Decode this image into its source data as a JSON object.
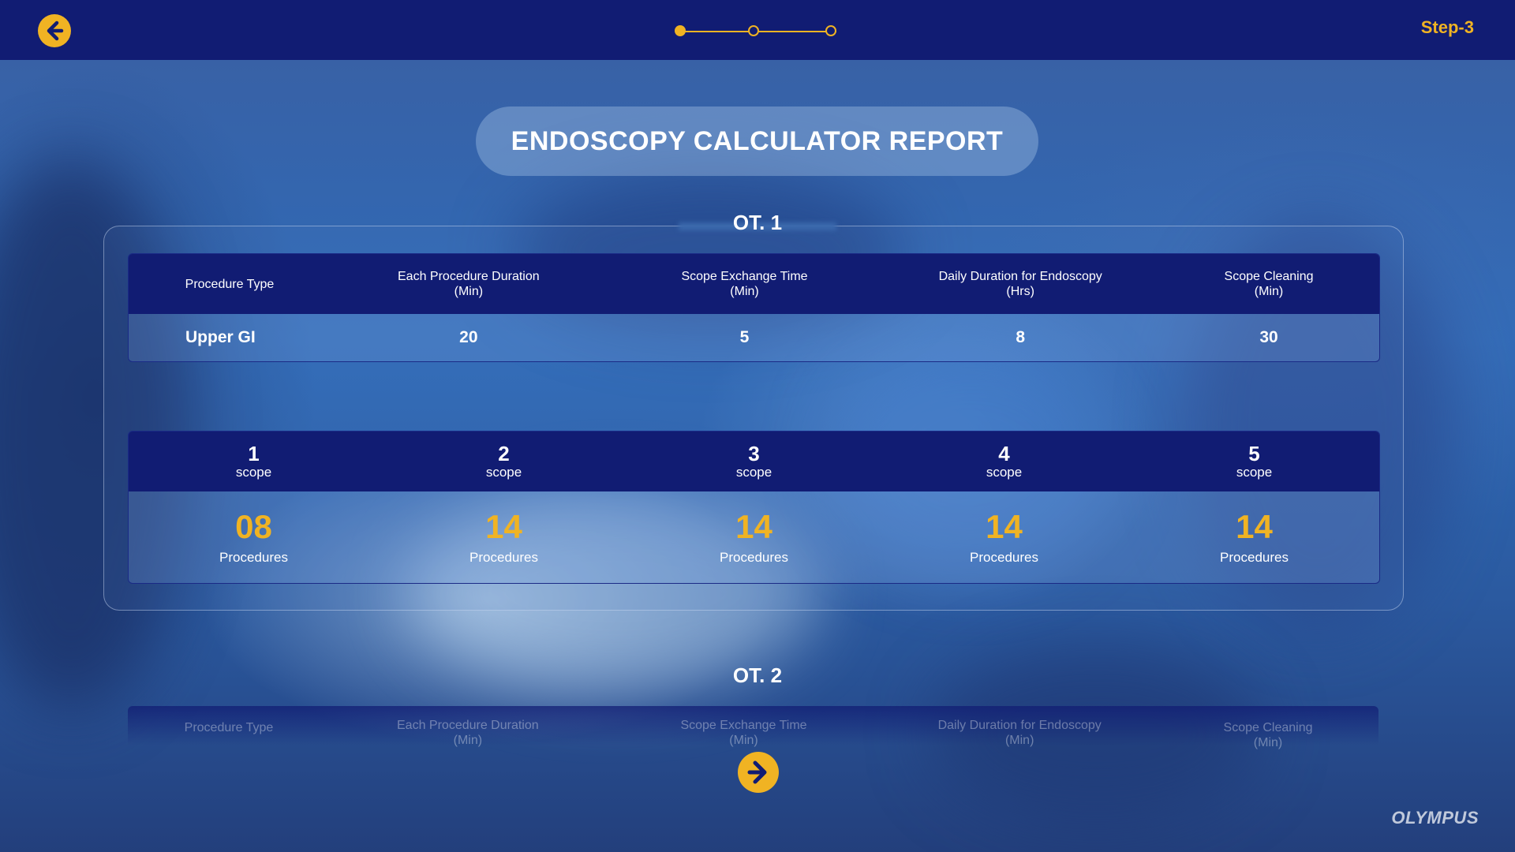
{
  "header": {
    "step_label": "Step-3",
    "progress": {
      "current_step": 1,
      "total_steps": 3
    }
  },
  "title": "ENDOSCOPY CALCULATOR REPORT",
  "ot1": {
    "title": "OT. 1",
    "columns": [
      [
        "Procedure Type"
      ],
      [
        "Each Procedure Duration",
        "(Min)"
      ],
      [
        "Scope Exchange Time",
        "(Min)"
      ],
      [
        "Daily Duration for Endoscopy",
        "(Hrs)"
      ],
      [
        "Scope Cleaning",
        "(Min)"
      ]
    ],
    "values": [
      "Upper GI",
      "20",
      "5",
      "8",
      "30"
    ],
    "scopes": [
      {
        "num": "1",
        "label": "scope",
        "procedures": "08",
        "proc_label": "Procedures"
      },
      {
        "num": "2",
        "label": "scope",
        "procedures": "14",
        "proc_label": "Procedures"
      },
      {
        "num": "3",
        "label": "scope",
        "procedures": "14",
        "proc_label": "Procedures"
      },
      {
        "num": "4",
        "label": "scope",
        "procedures": "14",
        "proc_label": "Procedures"
      },
      {
        "num": "5",
        "label": "scope",
        "procedures": "14",
        "proc_label": "Procedures"
      }
    ]
  },
  "ot2": {
    "title": "OT. 2",
    "columns": [
      [
        "Procedure Type"
      ],
      [
        "Each Procedure Duration",
        "(Min)"
      ],
      [
        "Scope Exchange Time",
        "(Min)"
      ],
      [
        "Daily Duration for Endoscopy",
        "(Min)"
      ],
      [
        "Scope Cleaning",
        "(Min)"
      ]
    ]
  },
  "footer": {
    "logo": "OLYMPUS"
  },
  "colors": {
    "navy": "#111c73",
    "accent": "#f0b323"
  },
  "icons": {
    "back": "arrow-left-circle-icon",
    "next": "arrow-right-circle-icon"
  }
}
